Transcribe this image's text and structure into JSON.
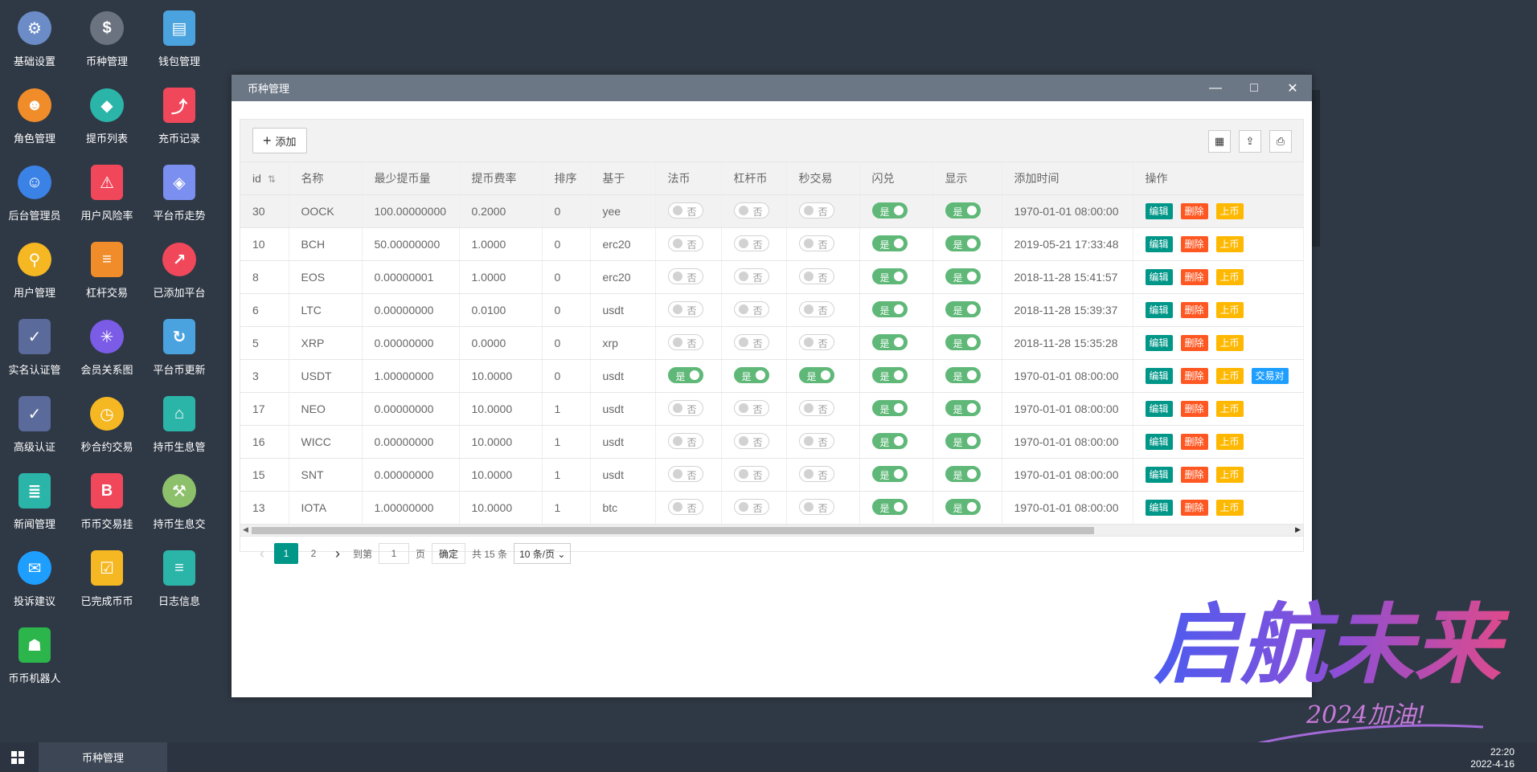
{
  "desktop": {
    "icons": [
      {
        "label": "基础设置",
        "icon": "gear-icon",
        "color": "#6b8cc7"
      },
      {
        "label": "币种管理",
        "icon": "dollar-icon",
        "color": "#6b7380"
      },
      {
        "label": "钱包管理",
        "icon": "wallet-icon",
        "color": "#4aa3df"
      },
      {
        "label": "角色管理",
        "icon": "roles-icon",
        "color": "#f08c2a"
      },
      {
        "label": "提币列表",
        "icon": "withdraw-icon",
        "color": "#2bb5a9"
      },
      {
        "label": "充币记录",
        "icon": "deposit-icon",
        "color": "#f0485a"
      },
      {
        "label": "后台管理员",
        "icon": "admin-icon",
        "color": "#3b82e6"
      },
      {
        "label": "用户风险率",
        "icon": "alarm-icon",
        "color": "#f0485a"
      },
      {
        "label": "平台币走势",
        "icon": "layers-icon",
        "color": "#7b8ff0"
      },
      {
        "label": "用户管理",
        "icon": "user-search-icon",
        "color": "#f5b722"
      },
      {
        "label": "杠杆交易",
        "icon": "stack-icon",
        "color": "#f08c2a"
      },
      {
        "label": "已添加平台",
        "icon": "trend-icon",
        "color": "#f0485a"
      },
      {
        "label": "实名认证管",
        "icon": "verified-user-icon",
        "color": "#5a6a9a"
      },
      {
        "label": "会员关系图",
        "icon": "network-icon",
        "color": "#7b5ce6"
      },
      {
        "label": "平台币更新",
        "icon": "cloud-refresh-icon",
        "color": "#4aa3df"
      },
      {
        "label": "高级认证",
        "icon": "advanced-verify-icon",
        "color": "#5a6a9a"
      },
      {
        "label": "秒合约交易",
        "icon": "stopwatch-icon",
        "color": "#f5b722"
      },
      {
        "label": "持币生息管",
        "icon": "unlock-icon",
        "color": "#2bb5a9"
      },
      {
        "label": "新闻管理",
        "icon": "news-icon",
        "color": "#2bb5a9"
      },
      {
        "label": "币币交易挂",
        "icon": "bitcoin-bag-icon",
        "color": "#f0485a"
      },
      {
        "label": "持币生息交",
        "icon": "hammer-icon",
        "color": "#8cc06a"
      },
      {
        "label": "投诉建议",
        "icon": "mail-icon",
        "color": "#1e9fff"
      },
      {
        "label": "已完成币币",
        "icon": "checkbox-icon",
        "color": "#f5b722"
      },
      {
        "label": "日志信息",
        "icon": "log-icon",
        "color": "#2bb5a9"
      },
      {
        "label": "币币机器人",
        "icon": "robot-icon",
        "color": "#2bb54a"
      }
    ]
  },
  "window": {
    "title": "币种管理",
    "minimize": "—",
    "maximize": "□",
    "close": "✕"
  },
  "toolbar": {
    "add_plus": "+",
    "add_label": "添加",
    "columns_icon": "▦",
    "export_icon": "⇪",
    "print_icon": "⎙"
  },
  "table": {
    "headers": [
      "id",
      "名称",
      "最少提币量",
      "提币费率",
      "排序",
      "基于",
      "法币",
      "杠杆币",
      "秒交易",
      "闪兑",
      "显示",
      "添加时间",
      "操作"
    ],
    "sort_icon": "⇅",
    "yes": "是",
    "no": "否",
    "edit": "编辑",
    "delete": "删除",
    "list": "上币",
    "pair": "交易对",
    "rows": [
      {
        "id": "30",
        "name": "OOCK",
        "min": "100.00000000",
        "fee": "0.2000",
        "sort": "0",
        "base": "yee",
        "fiat": false,
        "lever": false,
        "second": false,
        "flash": true,
        "show": true,
        "time": "1970-01-01 08:00:00",
        "pair": false
      },
      {
        "id": "10",
        "name": "BCH",
        "min": "50.00000000",
        "fee": "1.0000",
        "sort": "0",
        "base": "erc20",
        "fiat": false,
        "lever": false,
        "second": false,
        "flash": true,
        "show": true,
        "time": "2019-05-21 17:33:48",
        "pair": false
      },
      {
        "id": "8",
        "name": "EOS",
        "min": "0.00000001",
        "fee": "1.0000",
        "sort": "0",
        "base": "erc20",
        "fiat": false,
        "lever": false,
        "second": false,
        "flash": true,
        "show": true,
        "time": "2018-11-28 15:41:57",
        "pair": false
      },
      {
        "id": "6",
        "name": "LTC",
        "min": "0.00000000",
        "fee": "0.0100",
        "sort": "0",
        "base": "usdt",
        "fiat": false,
        "lever": false,
        "second": false,
        "flash": true,
        "show": true,
        "time": "2018-11-28 15:39:37",
        "pair": false
      },
      {
        "id": "5",
        "name": "XRP",
        "min": "0.00000000",
        "fee": "0.0000",
        "sort": "0",
        "base": "xrp",
        "fiat": false,
        "lever": false,
        "second": false,
        "flash": true,
        "show": true,
        "time": "2018-11-28 15:35:28",
        "pair": false
      },
      {
        "id": "3",
        "name": "USDT",
        "min": "1.00000000",
        "fee": "10.0000",
        "sort": "0",
        "base": "usdt",
        "fiat": true,
        "lever": true,
        "second": true,
        "flash": true,
        "show": true,
        "time": "1970-01-01 08:00:00",
        "pair": true
      },
      {
        "id": "17",
        "name": "NEO",
        "min": "0.00000000",
        "fee": "10.0000",
        "sort": "1",
        "base": "usdt",
        "fiat": false,
        "lever": false,
        "second": false,
        "flash": true,
        "show": true,
        "time": "1970-01-01 08:00:00",
        "pair": false
      },
      {
        "id": "16",
        "name": "WICC",
        "min": "0.00000000",
        "fee": "10.0000",
        "sort": "1",
        "base": "usdt",
        "fiat": false,
        "lever": false,
        "second": false,
        "flash": true,
        "show": true,
        "time": "1970-01-01 08:00:00",
        "pair": false
      },
      {
        "id": "15",
        "name": "SNT",
        "min": "0.00000000",
        "fee": "10.0000",
        "sort": "1",
        "base": "usdt",
        "fiat": false,
        "lever": false,
        "second": false,
        "flash": true,
        "show": true,
        "time": "1970-01-01 08:00:00",
        "pair": false
      },
      {
        "id": "13",
        "name": "IOTA",
        "min": "1.00000000",
        "fee": "10.0000",
        "sort": "1",
        "base": "btc",
        "fiat": false,
        "lever": false,
        "second": false,
        "flash": true,
        "show": true,
        "time": "1970-01-01 08:00:00",
        "pair": false
      }
    ]
  },
  "pager": {
    "prev": "‹",
    "pages": [
      "1",
      "2"
    ],
    "next": "›",
    "goto_label": "到第",
    "goto_value": "1",
    "page_unit": "页",
    "confirm": "确定",
    "total": "共 15 条",
    "page_size": "10 条/页 ⌄"
  },
  "taskbar": {
    "task_title": "币种管理",
    "time": "22:20",
    "date": "2022-4-16"
  },
  "brand": {
    "title": "启航未来",
    "subtitle": "2024加油!"
  }
}
